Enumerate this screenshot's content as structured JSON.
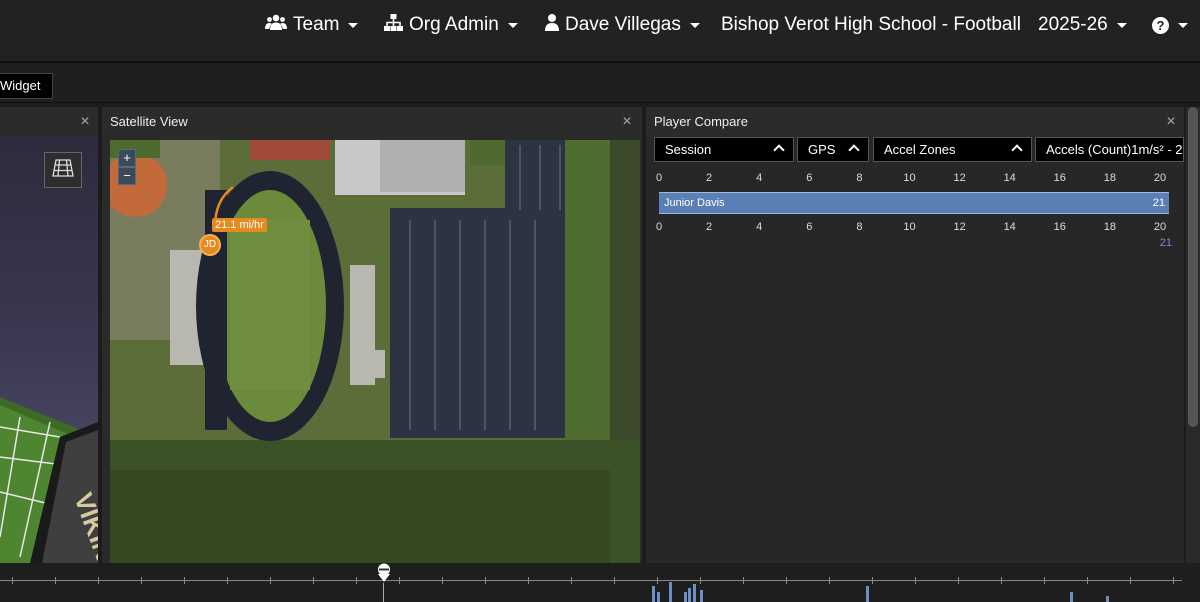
{
  "nav": {
    "team": "Team",
    "org_admin": "Org Admin",
    "user": "Dave Villegas",
    "organization": "Bishop Verot High School - Football",
    "season": "2025-26",
    "help": "?"
  },
  "tabs": {
    "widget_tab": "Widget"
  },
  "panels": {
    "three_d": {
      "field_text": "VIKINGS"
    },
    "satellite": {
      "title": "Satellite View",
      "zoom_in": "+",
      "zoom_out": "−",
      "speed_label": "21.1 mi/hr",
      "player_initials": "JD"
    },
    "compare": {
      "title": "Player Compare",
      "dropdowns": [
        "Session",
        "GPS",
        "Accel Zones",
        "Accels (Count)1m/s² - 2"
      ],
      "axis_ticks": [
        "0",
        "2",
        "4",
        "6",
        "8",
        "10",
        "12",
        "14",
        "16",
        "18",
        "20"
      ],
      "player_name": "Junior Davis",
      "value": "21",
      "total": "21"
    },
    "close_symbol": "×"
  },
  "chart_data": {
    "type": "bar",
    "categories": [
      "Junior Davis"
    ],
    "values": [
      21
    ],
    "xlim": [
      0,
      21
    ]
  },
  "colors": {
    "bar": "#5a7fb5",
    "marker": "#e58a1f",
    "total_text": "#6f94cc"
  }
}
